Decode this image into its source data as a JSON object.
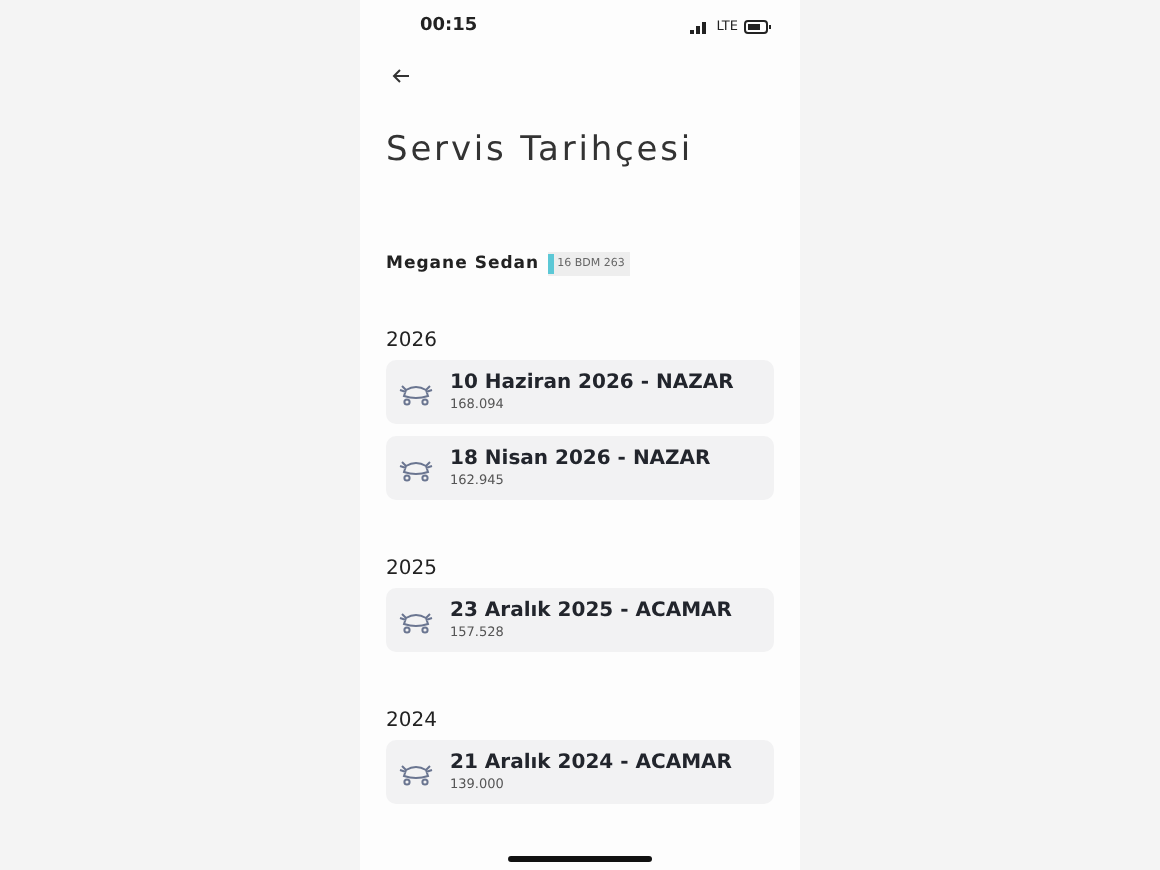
{
  "status_bar": {
    "time": "00:15",
    "network": "LTE"
  },
  "title": "Servis Tarihçesi",
  "vehicle": {
    "name": "Megane Sedan",
    "plate": "16 BDM 263"
  },
  "groups": [
    {
      "year": "2026",
      "records": [
        {
          "title": "10 Haziran 2026 - NAZAR",
          "mileage": "168.094"
        },
        {
          "title": "18 Nisan 2026 - NAZAR",
          "mileage": "162.945"
        }
      ]
    },
    {
      "year": "2025",
      "records": [
        {
          "title": "23 Aralık 2025 - ACAMAR",
          "mileage": "157.528"
        }
      ]
    },
    {
      "year": "2024",
      "records": [
        {
          "title": "21 Aralık 2024 - ACAMAR",
          "mileage": "139.000"
        }
      ]
    }
  ]
}
